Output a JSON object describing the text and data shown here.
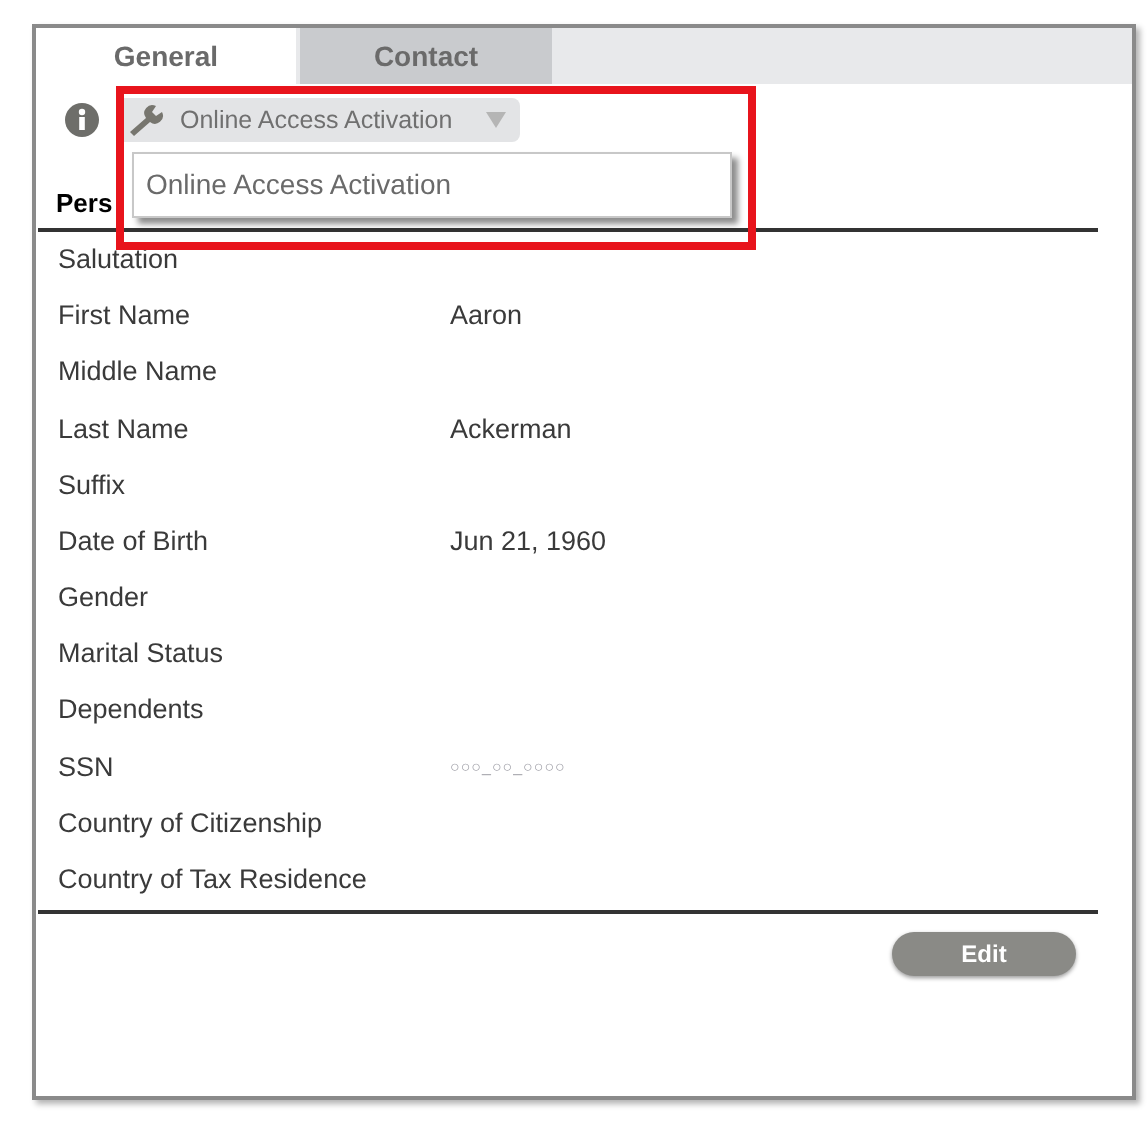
{
  "tabs": [
    {
      "label": "General",
      "selected": true
    },
    {
      "label": "Contact",
      "selected": false
    }
  ],
  "actions_menu": {
    "label": "Online Access Activation",
    "expanded": true,
    "items": [
      "Online Access Activation"
    ]
  },
  "section": {
    "title": "Pers"
  },
  "fields": [
    {
      "label": "Salutation"
    },
    {
      "label": "First Name",
      "value": "Aaron"
    },
    {
      "label": "Middle Name"
    },
    {
      "label": "Last Name",
      "value": "Ackerman"
    },
    {
      "label": "Suffix"
    },
    {
      "label": "Date of Birth",
      "value": "Jun 21, 1960"
    },
    {
      "label": "Gender"
    },
    {
      "label": "Marital Status"
    },
    {
      "label": "Dependents"
    },
    {
      "label": "SSN",
      "value": "○○○_○○_○○○○",
      "kind": "masked"
    },
    {
      "label": "Country of Citizenship"
    },
    {
      "label": "Country of Tax Residence"
    }
  ],
  "buttons": [
    {
      "label": "Edit"
    }
  ]
}
